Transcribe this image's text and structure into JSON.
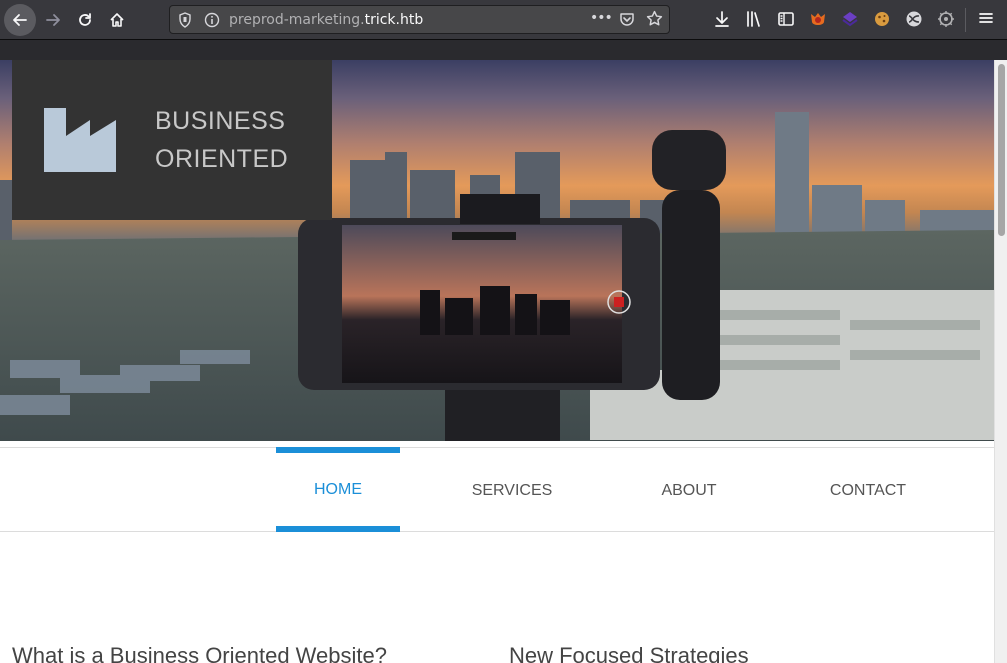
{
  "browser": {
    "url_prefix": "preprod-marketing.",
    "url_domain": "trick.htb",
    "page_actions": "•••"
  },
  "site": {
    "logo_line1": "BUSINESS",
    "logo_line2": "ORIENTED",
    "nav": [
      {
        "label": "HOME",
        "active": true
      },
      {
        "label": "SERVICES",
        "active": false
      },
      {
        "label": "ABOUT",
        "active": false
      },
      {
        "label": "CONTACT",
        "active": false
      }
    ],
    "heading_left": "What is a Business Oriented Website?",
    "heading_right": "New Focused Strategies"
  },
  "colors": {
    "accent": "#1b8fd8",
    "logo_box": "#333333",
    "logo_icon": "#b9c9d9"
  }
}
